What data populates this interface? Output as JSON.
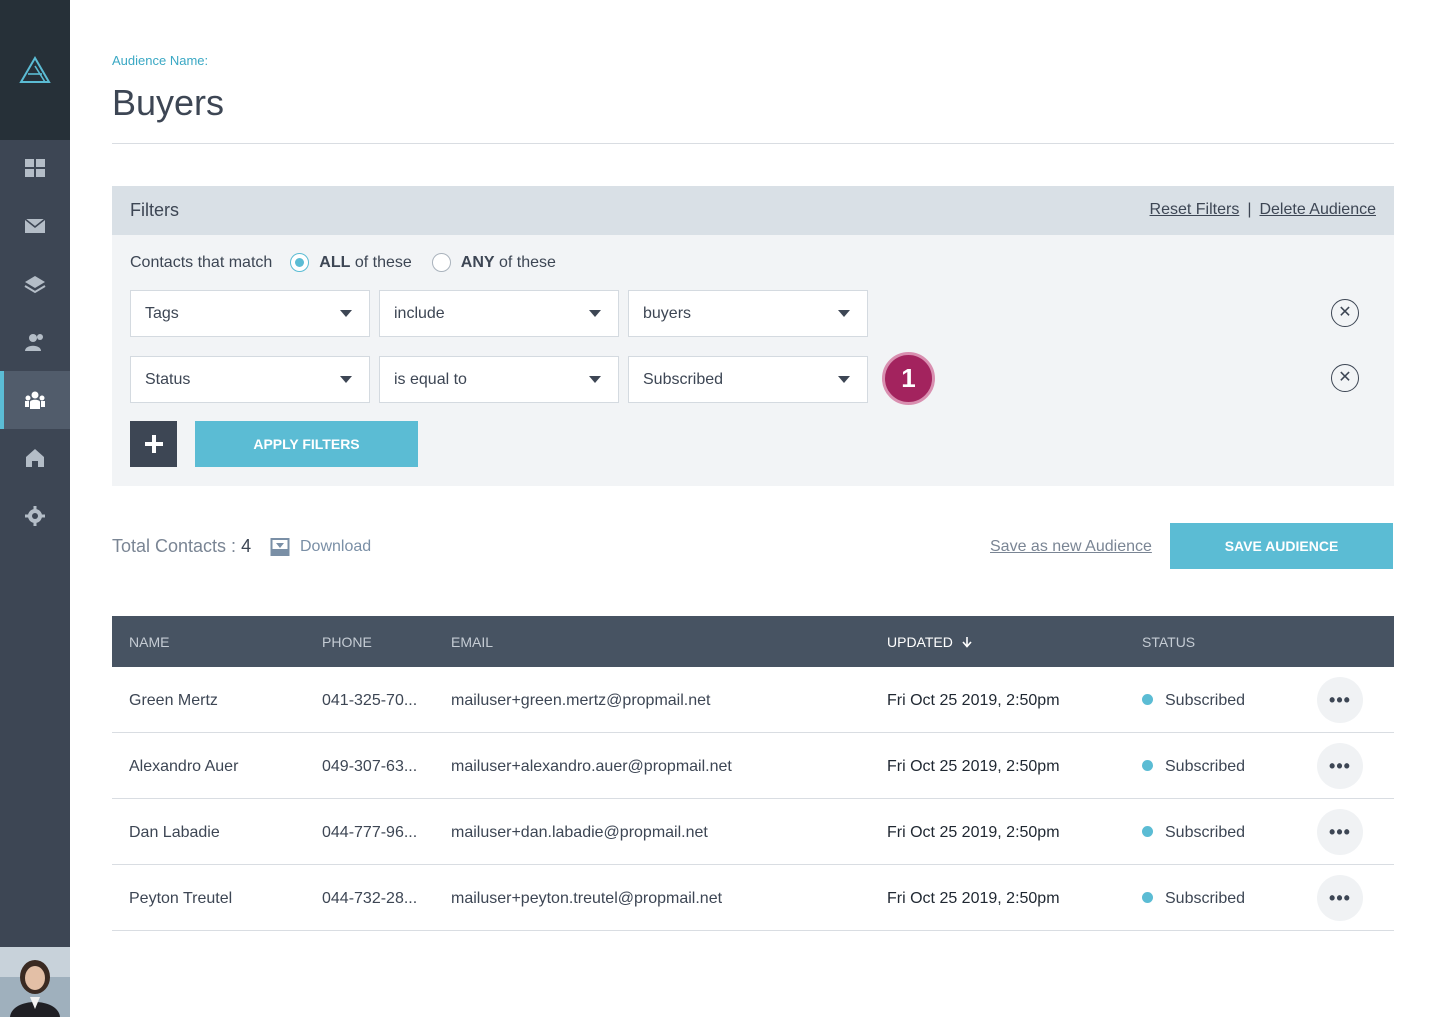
{
  "sidebar": {
    "logo": "triangle-logo",
    "items": [
      {
        "icon": "dashboard-grid-icon"
      },
      {
        "icon": "mail-icon"
      },
      {
        "icon": "layers-icon"
      },
      {
        "icon": "contacts-icon"
      },
      {
        "icon": "audience-icon",
        "active": true
      },
      {
        "icon": "home-icon"
      },
      {
        "icon": "gear-icon"
      }
    ]
  },
  "audience": {
    "label": "Audience Name:",
    "name": "Buyers"
  },
  "filters": {
    "title": "Filters",
    "reset_label": "Reset Filters",
    "separator": "|",
    "delete_label": "Delete Audience",
    "match_label": "Contacts that match",
    "all_bold": "ALL",
    "all_rest": " of these",
    "any_bold": "ANY",
    "any_rest": " of these",
    "selected_match": "ALL",
    "rows": [
      {
        "field": "Tags",
        "operator": "include",
        "value": "buyers"
      },
      {
        "field": "Status",
        "operator": "is equal to",
        "value": "Subscribed"
      }
    ],
    "add_label": "+",
    "apply_label": "APPLY FILTERS"
  },
  "annotation_badge": "1",
  "totals": {
    "label": "Total Contacts : ",
    "count": "4",
    "download_label": "Download",
    "save_new_label": "Save as new Audience",
    "save_label": "SAVE AUDIENCE"
  },
  "table": {
    "headers": {
      "name": "NAME",
      "phone": "PHONE",
      "email": "EMAIL",
      "updated": "UPDATED",
      "status": "STATUS"
    },
    "rows": [
      {
        "name": "Green Mertz",
        "phone": "041-325-70...",
        "email": "mailuser+green.mertz@propmail.net",
        "updated": "Fri Oct 25 2019, 2:50pm",
        "status": "Subscribed"
      },
      {
        "name": "Alexandro Auer",
        "phone": "049-307-63...",
        "email": "mailuser+alexandro.auer@propmail.net",
        "updated": "Fri Oct 25 2019, 2:50pm",
        "status": "Subscribed"
      },
      {
        "name": "Dan Labadie",
        "phone": "044-777-96...",
        "email": "mailuser+dan.labadie@propmail.net",
        "updated": "Fri Oct 25 2019, 2:50pm",
        "status": "Subscribed"
      },
      {
        "name": "Peyton Treutel",
        "phone": "044-732-28...",
        "email": "mailuser+peyton.treutel@propmail.net",
        "updated": "Fri Oct 25 2019, 2:50pm",
        "status": "Subscribed"
      }
    ],
    "more_label": "•••"
  },
  "colors": {
    "accent": "#5bbcd4",
    "sidebar": "#3d4654",
    "badge": "#a3235e"
  }
}
